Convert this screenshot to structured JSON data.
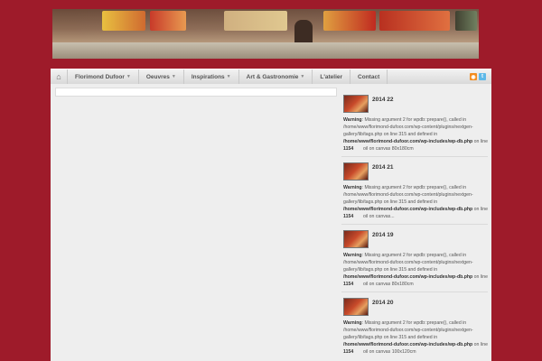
{
  "nav": {
    "items": [
      {
        "label": "Florimond Dufoor",
        "caret": true
      },
      {
        "label": "Oeuvres",
        "caret": true
      },
      {
        "label": "Inspirations",
        "caret": true
      },
      {
        "label": "Art & Gastronomie",
        "caret": true
      },
      {
        "label": "L'atelier",
        "caret": false
      },
      {
        "label": "Contact",
        "caret": false
      }
    ]
  },
  "posts": [
    {
      "title": "2014 22",
      "warning": "Warning",
      "text_1": ": Missing argument 2 for wpdb::prepare(), called in /home/www/florimond-dufoor.com/wp-content/plugins/nextgen-gallery/lib/tags.php on line 315 and defined in ",
      "path": "/home/www/florimond-dufoor.com/wp-includes/wp-db.php",
      "text_2": " on line ",
      "line": "1154",
      "meta": "oil on canvas 80x180cm"
    },
    {
      "title": "2014 21",
      "warning": "Warning",
      "text_1": ": Missing argument 2 for wpdb::prepare(), called in /home/www/florimond-dufoor.com/wp-content/plugins/nextgen-gallery/lib/tags.php on line 315 and defined in ",
      "path": "/home/www/florimond-dufoor.com/wp-includes/wp-db.php",
      "text_2": " on line ",
      "line": "1154",
      "meta": "oil on canvas..."
    },
    {
      "title": "2014 19",
      "warning": "Warning",
      "text_1": ": Missing argument 2 for wpdb::prepare(), called in /home/www/florimond-dufoor.com/wp-content/plugins/nextgen-gallery/lib/tags.php on line 315 and defined in ",
      "path": "/home/www/florimond-dufoor.com/wp-includes/wp-db.php",
      "text_2": " on line ",
      "line": "1154",
      "meta": "oil on canvas 80x180cm"
    },
    {
      "title": "2014 20",
      "warning": "Warning",
      "text_1": ": Missing argument 2 for wpdb::prepare(), called in /home/www/florimond-dufoor.com/wp-content/plugins/nextgen-gallery/lib/tags.php on line 315 and defined in ",
      "path": "/home/www/florimond-dufoor.com/wp-includes/wp-db.php",
      "text_2": " on line ",
      "line": "1154",
      "meta": "oil on canvas 100x120cm"
    }
  ]
}
